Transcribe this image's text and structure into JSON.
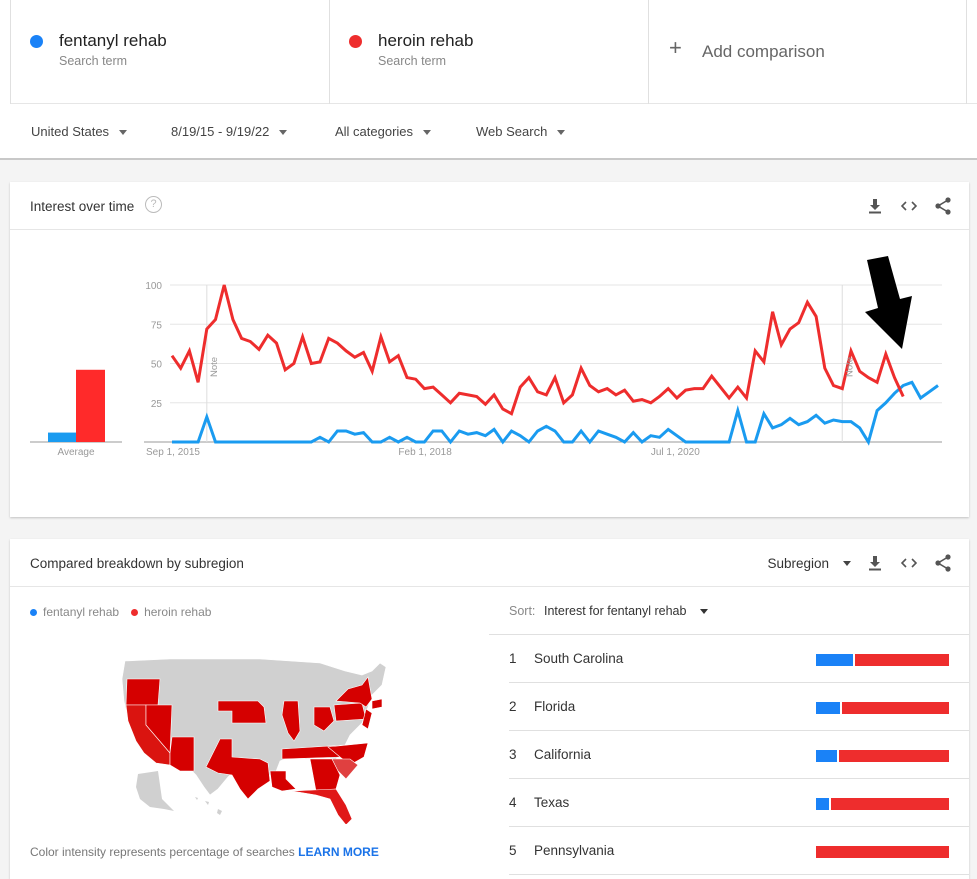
{
  "search_terms": [
    {
      "name": "fentanyl rehab",
      "subtitle": "Search term",
      "color": "#1a82f7"
    },
    {
      "name": "heroin rehab",
      "subtitle": "Search term",
      "color": "#ee2d2d"
    }
  ],
  "add_comparison": {
    "icon": "plus-icon",
    "label": "Add comparison"
  },
  "filters": {
    "region": "United States",
    "date_range": "8/19/15 - 9/19/22",
    "category": "All categories",
    "search_type": "Web Search"
  },
  "interest_over_time": {
    "title": "Interest over time",
    "help_icon": "?",
    "actions": [
      "download-icon",
      "embed-icon",
      "share-icon"
    ]
  },
  "chart_data": {
    "type": "line",
    "title": "Interest over time",
    "xlabel": "",
    "ylabel": "",
    "ylim": [
      0,
      100
    ],
    "yticks": [
      25,
      50,
      75,
      100
    ],
    "grid": true,
    "x_tick_labels": [
      {
        "label": "Sep 1, 2015",
        "index": 0
      },
      {
        "label": "Feb 1, 2018",
        "index": 29
      },
      {
        "label": "Jul 1, 2020",
        "index": 58
      }
    ],
    "notes": [
      {
        "label": "Note",
        "index": 4
      },
      {
        "label": "Note",
        "index": 77
      }
    ],
    "average": {
      "label": "Average",
      "values": {
        "fentanyl rehab": 6,
        "heroin rehab": 46
      }
    },
    "series": [
      {
        "name": "fentanyl rehab",
        "color": "#1a9bf0",
        "values": [
          0,
          0,
          0,
          0,
          16,
          0,
          0,
          0,
          0,
          0,
          0,
          0,
          0,
          0,
          0,
          0,
          0,
          3,
          0,
          7,
          7,
          5,
          6,
          0,
          0,
          3,
          0,
          3,
          0,
          0,
          7,
          7,
          0,
          7,
          5,
          6,
          4,
          8,
          0,
          7,
          4,
          0,
          7,
          10,
          7,
          0,
          0,
          7,
          0,
          7,
          5,
          3,
          0,
          6,
          0,
          4,
          3,
          8,
          4,
          0,
          0,
          0,
          0,
          0,
          0,
          20,
          0,
          0,
          18,
          9,
          11,
          15,
          11,
          13,
          17,
          12,
          14,
          13,
          13,
          9,
          0,
          20,
          25,
          31,
          36,
          38,
          28,
          32,
          36
        ]
      },
      {
        "name": "heroin rehab",
        "color": "#ee2d2d",
        "values": [
          55,
          47,
          58,
          38,
          72,
          78,
          100,
          78,
          66,
          64,
          59,
          68,
          63,
          46,
          50,
          67,
          50,
          51,
          66,
          63,
          58,
          54,
          57,
          45,
          67,
          51,
          55,
          41,
          40,
          34,
          35,
          30,
          25,
          31,
          30,
          29,
          24,
          30,
          21,
          18,
          35,
          41,
          32,
          30,
          41,
          25,
          30,
          47,
          36,
          32,
          34,
          30,
          33,
          26,
          27,
          25,
          29,
          34,
          28,
          33,
          34,
          34,
          42,
          35,
          28,
          35,
          28,
          58,
          51,
          83,
          62,
          72,
          76,
          89,
          80,
          47,
          36,
          34,
          58,
          45,
          41,
          38,
          56,
          41,
          29
        ]
      }
    ]
  },
  "subregion": {
    "title": "Compared breakdown by subregion",
    "view_select": "Subregion",
    "legend": [
      {
        "name": "fentanyl rehab",
        "color": "#1a82f7"
      },
      {
        "name": "heroin rehab",
        "color": "#ee2d2d"
      }
    ],
    "sort_label": "Sort:",
    "sort_value": "Interest for fentanyl rehab",
    "map_note": "Color intensity represents percentage of searches",
    "learn_more": "LEARN MORE",
    "highlighted_states": [
      "Oregon",
      "California",
      "Nevada",
      "Arizona",
      "Nebraska",
      "Texas",
      "Louisiana",
      "Illinois",
      "Ohio",
      "Tennessee",
      "Georgia",
      "South Carolina",
      "North Carolina",
      "Florida",
      "Pennsylvania",
      "New York",
      "New Jersey",
      "Connecticut"
    ],
    "rows": [
      {
        "rank": "1",
        "state": "South Carolina",
        "fentanyl_pct": 28,
        "heroin_pct": 72
      },
      {
        "rank": "2",
        "state": "Florida",
        "fentanyl_pct": 18,
        "heroin_pct": 82
      },
      {
        "rank": "3",
        "state": "California",
        "fentanyl_pct": 16,
        "heroin_pct": 84
      },
      {
        "rank": "4",
        "state": "Texas",
        "fentanyl_pct": 10,
        "heroin_pct": 90
      },
      {
        "rank": "5",
        "state": "Pennsylvania",
        "fentanyl_pct": 0,
        "heroin_pct": 100
      }
    ]
  }
}
